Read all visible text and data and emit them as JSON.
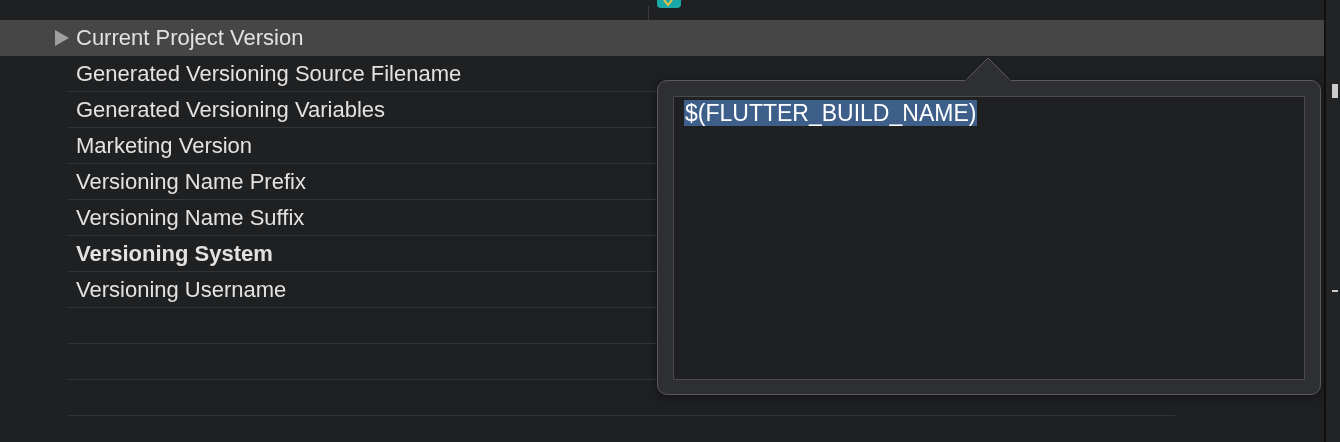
{
  "settings": [
    {
      "name": "Current Project Version",
      "bold": false,
      "selected": true,
      "expandable": true
    },
    {
      "name": "Generated Versioning Source Filename",
      "bold": false,
      "selected": false,
      "expandable": false
    },
    {
      "name": "Generated Versioning Variables",
      "bold": false,
      "selected": false,
      "expandable": false
    },
    {
      "name": "Marketing Version",
      "bold": false,
      "selected": false,
      "expandable": false
    },
    {
      "name": "Versioning Name Prefix",
      "bold": false,
      "selected": false,
      "expandable": false
    },
    {
      "name": "Versioning Name Suffix",
      "bold": false,
      "selected": false,
      "expandable": false
    },
    {
      "name": "Versioning System",
      "bold": true,
      "selected": false,
      "expandable": false
    },
    {
      "name": "Versioning Username",
      "bold": false,
      "selected": false,
      "expandable": false
    }
  ],
  "popover": {
    "value": "$(FLUTTER_BUILD_NAME)",
    "text_selected": true
  }
}
